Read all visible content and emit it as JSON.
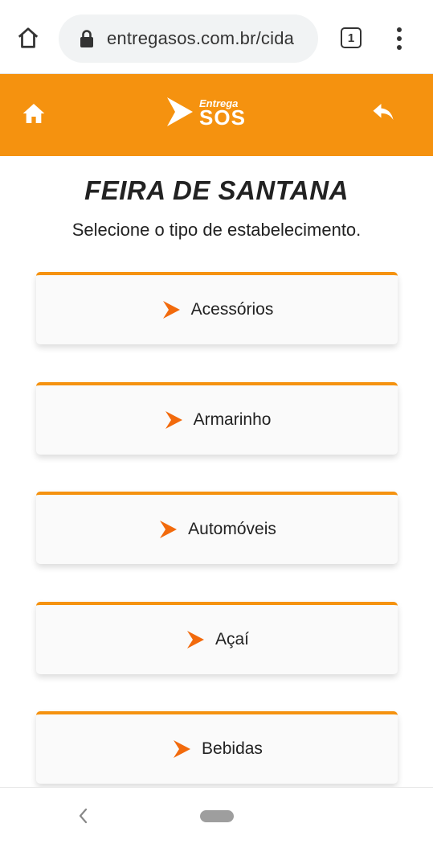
{
  "browser": {
    "url": "entregasos.com.br/cida",
    "tab_count": "1"
  },
  "header": {
    "logo_top": "Entrega",
    "logo_bottom": "SOS"
  },
  "main": {
    "title": "FEIRA DE SANTANA",
    "subtitle": "Selecione o tipo de estabelecimento.",
    "categories": [
      {
        "label": "Acessórios"
      },
      {
        "label": "Armarinho"
      },
      {
        "label": "Automóveis"
      },
      {
        "label": "Açaí"
      },
      {
        "label": "Bebidas"
      }
    ]
  },
  "colors": {
    "accent": "#f5920f",
    "arrow": "#f26a0c"
  },
  "icons": {
    "browser_home": "home-outline-icon",
    "lock": "lock-icon",
    "menu": "more-vertical-icon",
    "site_home": "home-icon",
    "site_back": "reply-arrow-icon",
    "category_arrow": "chevron-right-icon"
  }
}
